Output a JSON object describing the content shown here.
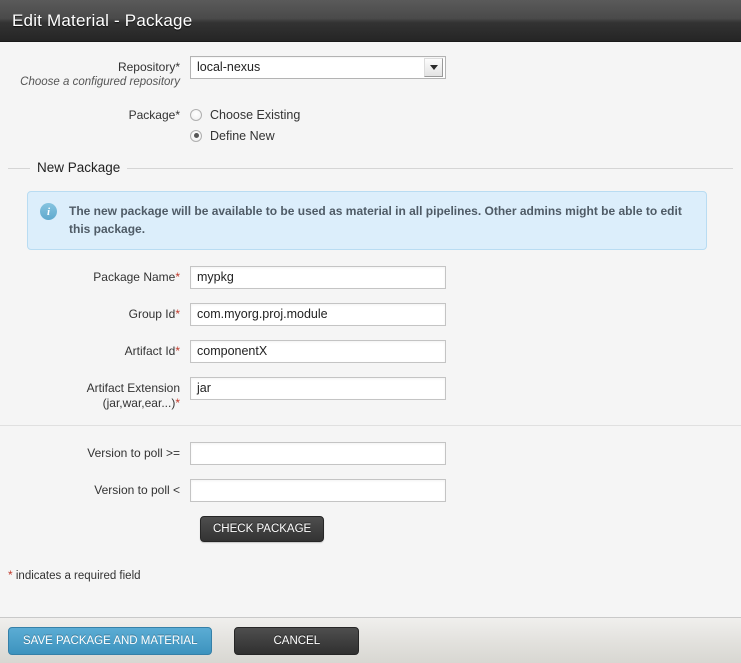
{
  "window": {
    "title": "Edit Material - Package"
  },
  "repository": {
    "label": "Repository",
    "required_mark": "*",
    "hint": "Choose a configured repository",
    "selected": "local-nexus",
    "options": [
      "local-nexus"
    ],
    "caret_icon": "chevron-down-icon"
  },
  "package": {
    "label": "Package",
    "required_mark": "*",
    "options": [
      {
        "label": "Choose Existing",
        "selected": false
      },
      {
        "label": "Define New",
        "selected": true
      }
    ]
  },
  "new_package": {
    "legend": "New Package",
    "info": {
      "icon": "info-icon",
      "icon_glyph": "i",
      "text": "The new package will be available to be used as material in all pipelines. Other admins might be able to edit this package."
    },
    "fields": [
      {
        "label": "Package Name",
        "required_mark": "*",
        "value": "mypkg",
        "placeholder": ""
      },
      {
        "label": "Group Id",
        "required_mark": "*",
        "value": "com.myorg.proj.module",
        "placeholder": ""
      },
      {
        "label": "Artifact Id",
        "required_mark": "*",
        "value": "componentX",
        "placeholder": ""
      },
      {
        "label": "Artifact Extension",
        "label_line2": "(jar,war,ear...)",
        "required_mark": "*",
        "value": "jar",
        "placeholder": ""
      }
    ],
    "version_fields": [
      {
        "label": "Version to poll >=",
        "value": "",
        "placeholder": ""
      },
      {
        "label": "Version to poll <",
        "value": "",
        "placeholder": ""
      }
    ],
    "check_button": "CHECK PACKAGE"
  },
  "required_note": {
    "mark": "*",
    "text": "indicates a required field"
  },
  "footer": {
    "save_label": "SAVE PACKAGE AND MATERIAL",
    "cancel_label": "CANCEL"
  },
  "colors": {
    "accent_blue": "#3d93be",
    "info_bg": "#dceefb",
    "required_red": "#c0392b",
    "titlebar_dark": "#252525"
  }
}
